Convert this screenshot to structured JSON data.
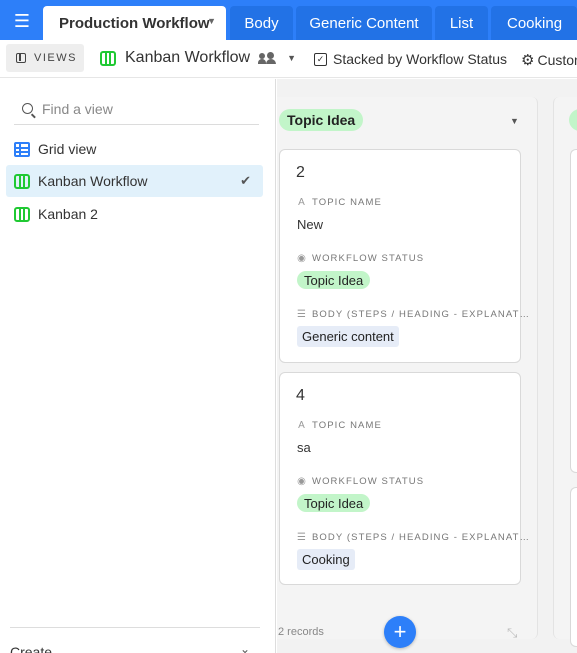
{
  "tabs": {
    "menu_icon": "hamburger-icon",
    "active": {
      "label": "Production Workflow"
    },
    "others": [
      {
        "label": "Body"
      },
      {
        "label": "Generic Content"
      },
      {
        "label": "List"
      },
      {
        "label": "Cooking"
      }
    ]
  },
  "toolbar": {
    "views_label": "VIEWS",
    "view_name": "Kanban Workflow",
    "stacked_label": "Stacked by Workflow Status",
    "customize_label": "Custon"
  },
  "sidebar": {
    "search_placeholder": "Find a view",
    "views": [
      {
        "label": "Grid view",
        "icon": "grid-view-icon"
      },
      {
        "label": "Kanban Workflow",
        "icon": "kanban-icon",
        "selected": true
      },
      {
        "label": "Kanban 2",
        "icon": "kanban-icon"
      }
    ],
    "create_label": "Create"
  },
  "board": {
    "stack": {
      "title": "Topic Idea",
      "records_label": "2 records",
      "color": "#c2f5c9"
    },
    "cards": [
      {
        "title": "2",
        "fields": [
          {
            "label": "TOPIC NAME",
            "value": "New"
          },
          {
            "label": "WORKFLOW STATUS",
            "value": "Topic Idea"
          },
          {
            "label": "BODY (STEPS / HEADING - EXPLANAT…",
            "value": "Generic content"
          }
        ]
      },
      {
        "title": "4",
        "fields": [
          {
            "label": "TOPIC NAME",
            "value": "sa"
          },
          {
            "label": "WORKFLOW STATUS",
            "value": "Topic Idea"
          },
          {
            "label": "BODY (STEPS / HEADING - EXPLANAT…",
            "value": "Cooking"
          }
        ]
      }
    ]
  },
  "colors": {
    "brand_blue": "#2d7ff9",
    "kanban_green": "#20c933",
    "status_green": "#c2f5c9",
    "link_chip_blue": "#e6ecf7"
  }
}
